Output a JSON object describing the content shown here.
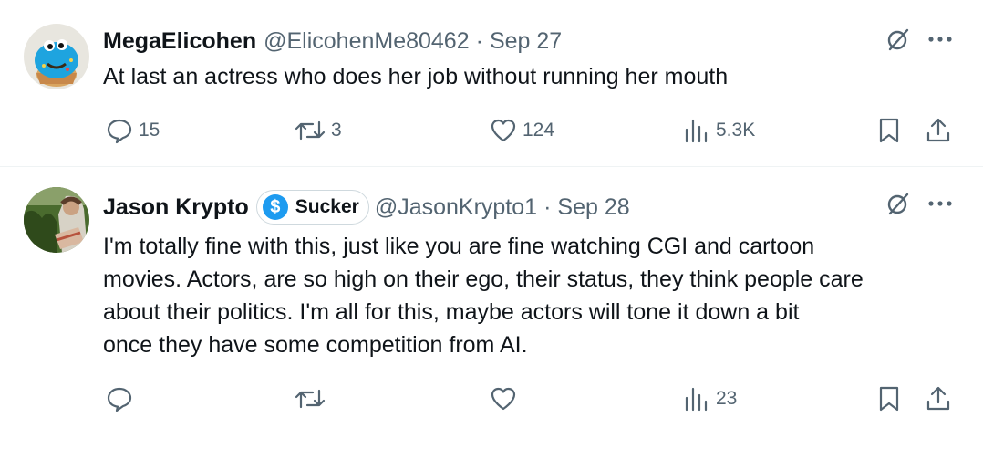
{
  "tweets": [
    {
      "display_name": "MegaElicohen",
      "handle": "@ElicohenMe80462",
      "separator": "·",
      "date": "Sep 27",
      "badge": null,
      "lines": [
        "At last an actress who does her job without running her mouth"
      ],
      "replies": "15",
      "retweets": "3",
      "likes": "124",
      "views": "5.3K"
    },
    {
      "display_name": "Jason Krypto",
      "handle": "@JasonKrypto1",
      "separator": "·",
      "date": "Sep 28",
      "badge": {
        "icon": "$",
        "label": "Sucker"
      },
      "lines": [
        "I'm totally fine with this, just like you are fine watching CGI and cartoon",
        "movies.  Actors, are so high on their ego, their status, they think people care",
        "about their politics.  I'm all for this, maybe actors will tone it down a bit",
        "once they have some competition from AI."
      ],
      "replies": "",
      "retweets": "",
      "likes": "",
      "views": "23"
    }
  ],
  "icons": {
    "top": [
      "grok-icon",
      "more-icon"
    ],
    "actions": [
      "reply-icon",
      "retweet-icon",
      "like-icon",
      "views-icon",
      "bookmark-icon",
      "share-icon"
    ]
  },
  "colors": {
    "text": "#0f1419",
    "secondary": "#536471",
    "accent": "#1d9bf0",
    "divider": "#eff3f4"
  }
}
